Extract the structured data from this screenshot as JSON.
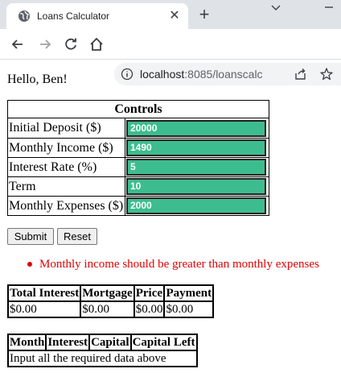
{
  "browser": {
    "tab_title": "Loans Calculator",
    "url_host": "localhost",
    "url_rest": ":8085/loanscalc",
    "icons": [
      "globe-icon",
      "close-icon",
      "plus-icon",
      "back-icon",
      "forward-icon",
      "reload-icon",
      "home-icon",
      "info-icon",
      "share-icon",
      "star-icon",
      "chevron-down-icon",
      "minimize-icon"
    ]
  },
  "page": {
    "greeting": "Hello, Ben!",
    "controls": {
      "header": "Controls",
      "fields": [
        {
          "label": "Initial Deposit ($)",
          "value": "20000"
        },
        {
          "label": "Monthly Income ($)",
          "value": "1490"
        },
        {
          "label": "Interest Rate (%)",
          "value": "5"
        },
        {
          "label": "Term",
          "value": "10"
        },
        {
          "label": "Monthly Expenses ($)",
          "value": "2000"
        }
      ]
    },
    "buttons": {
      "submit": "Submit",
      "reset": "Reset"
    },
    "errors": [
      "Monthly income should be greater than monthly expenses"
    ],
    "results": {
      "headers": [
        "Total Interest",
        "Mortgage",
        "Price",
        "Payment"
      ],
      "row": [
        "$0.00",
        "$0.00",
        "$0.00",
        "$0.00"
      ]
    },
    "schedule": {
      "headers": [
        "Month",
        "Interest",
        "Capital",
        "Capital Left"
      ],
      "empty_message": "Input all the required data above"
    }
  },
  "colors": {
    "field_bg": "#3dbd8f",
    "error": "#e00000"
  }
}
